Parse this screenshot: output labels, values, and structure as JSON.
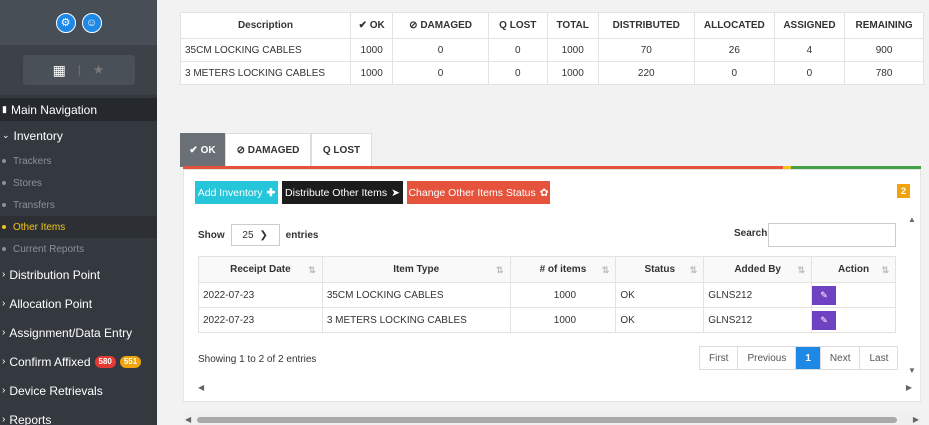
{
  "sidebar": {
    "head": "Main Navigation",
    "inventory": "Inventory",
    "subitems": [
      "Trackers",
      "Stores",
      "Transfers",
      "Other Items",
      "Current Reports"
    ],
    "items": [
      "Distribution Point",
      "Allocation Point",
      "Assignment/Data Entry",
      "Confirm Affixed",
      "Device Retrievals",
      "Reports"
    ],
    "confirm_badges": [
      "580",
      "551"
    ]
  },
  "summary": {
    "headers": [
      "Description",
      "✔ OK",
      "⊘ DAMAGED",
      "Q LOST",
      "TOTAL",
      "DISTRIBUTED",
      "ALLOCATED",
      "ASSIGNED",
      "REMAINING"
    ],
    "rows": [
      [
        "35CM LOCKING CABLES",
        "1000",
        "0",
        "0",
        "1000",
        "70",
        "26",
        "4",
        "900"
      ],
      [
        "3 METERS LOCKING CABLES",
        "1000",
        "0",
        "0",
        "1000",
        "220",
        "0",
        "0",
        "780"
      ]
    ]
  },
  "tabs": [
    "✔ OK",
    "⊘ DAMAGED",
    "Q LOST"
  ],
  "buttons": {
    "add": "Add Inventory",
    "distribute": "Distribute Other Items",
    "change": "Change Other Items Status"
  },
  "count_badge": "2",
  "table_controls": {
    "show": "Show",
    "entries_value": "25",
    "entries": "entries",
    "search": "Search:"
  },
  "items_table": {
    "headers": [
      "Receipt Date",
      "Item Type",
      "# of items",
      "Status",
      "Added By",
      "Action"
    ],
    "rows": [
      [
        "2022-07-23",
        "35CM LOCKING CABLES",
        "1000",
        "OK",
        "GLNS212"
      ],
      [
        "2022-07-23",
        "3 METERS LOCKING CABLES",
        "1000",
        "OK",
        "GLNS212"
      ]
    ]
  },
  "footer": {
    "info": "Showing 1 to 2 of 2 entries",
    "pages": [
      "First",
      "Previous",
      "1",
      "Next",
      "Last"
    ]
  },
  "colors": {
    "add": "#26c6da",
    "distribute": "#1c1c1c",
    "change": "#e5533d",
    "purple": "#6f42c1",
    "blue": "#1e88e5"
  }
}
